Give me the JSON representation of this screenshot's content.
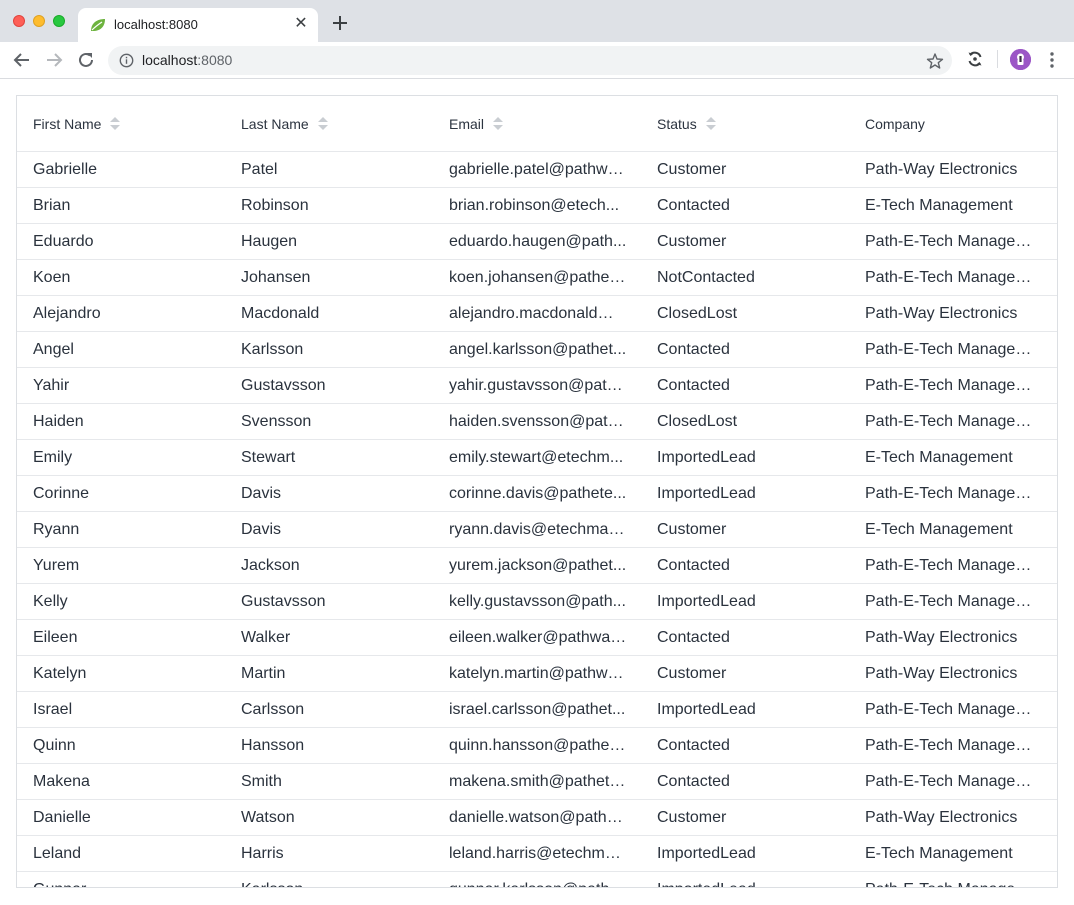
{
  "browser": {
    "tab_title": "localhost:8080",
    "url_host": "localhost",
    "url_port": ":8080"
  },
  "icons": {
    "favicon": "spring-leaf-icon",
    "tab_close": "close-icon",
    "new_tab": "plus-icon",
    "back": "arrow-left-icon",
    "forward": "arrow-right-icon",
    "reload": "reload-icon",
    "site_info": "info-icon",
    "bookmark": "star-icon",
    "extension": "sync-extension-icon",
    "profile": "avatar",
    "menu": "kebab-menu-icon"
  },
  "colors": {
    "traffic_red": "#fe5f57",
    "traffic_yellow": "#febc2e",
    "traffic_green": "#28c840",
    "favicon_green": "#6db33f",
    "avatar_purple": "#9b56c6"
  },
  "grid": {
    "columns": [
      {
        "label": "First Name",
        "sortable": true
      },
      {
        "label": "Last Name",
        "sortable": true
      },
      {
        "label": "Email",
        "sortable": true
      },
      {
        "label": "Status",
        "sortable": true
      },
      {
        "label": "Company",
        "sortable": false
      }
    ],
    "rows": [
      {
        "first": "Gabrielle",
        "last": "Patel",
        "email": "gabrielle.patel@pathwa...",
        "status": "Customer",
        "company": "Path-Way Electronics"
      },
      {
        "first": "Brian",
        "last": "Robinson",
        "email": "brian.robinson@etech...",
        "status": "Contacted",
        "company": "E-Tech Management"
      },
      {
        "first": "Eduardo",
        "last": "Haugen",
        "email": "eduardo.haugen@path...",
        "status": "Customer",
        "company": "Path-E-Tech Managem..."
      },
      {
        "first": "Koen",
        "last": "Johansen",
        "email": "koen.johansen@pathet...",
        "status": "NotContacted",
        "company": "Path-E-Tech Managem..."
      },
      {
        "first": "Alejandro",
        "last": "Macdonald",
        "email": "alejandro.macdonald@...",
        "status": "ClosedLost",
        "company": "Path-Way Electronics"
      },
      {
        "first": "Angel",
        "last": "Karlsson",
        "email": "angel.karlsson@pathet...",
        "status": "Contacted",
        "company": "Path-E-Tech Managem..."
      },
      {
        "first": "Yahir",
        "last": "Gustavsson",
        "email": "yahir.gustavsson@path...",
        "status": "Contacted",
        "company": "Path-E-Tech Managem..."
      },
      {
        "first": "Haiden",
        "last": "Svensson",
        "email": "haiden.svensson@path...",
        "status": "ClosedLost",
        "company": "Path-E-Tech Managem..."
      },
      {
        "first": "Emily",
        "last": "Stewart",
        "email": "emily.stewart@etechm...",
        "status": "ImportedLead",
        "company": "E-Tech Management"
      },
      {
        "first": "Corinne",
        "last": "Davis",
        "email": "corinne.davis@pathete...",
        "status": "ImportedLead",
        "company": "Path-E-Tech Managem..."
      },
      {
        "first": "Ryann",
        "last": "Davis",
        "email": "ryann.davis@etechman...",
        "status": "Customer",
        "company": "E-Tech Management"
      },
      {
        "first": "Yurem",
        "last": "Jackson",
        "email": "yurem.jackson@pathet...",
        "status": "Contacted",
        "company": "Path-E-Tech Managem..."
      },
      {
        "first": "Kelly",
        "last": "Gustavsson",
        "email": "kelly.gustavsson@path...",
        "status": "ImportedLead",
        "company": "Path-E-Tech Managem..."
      },
      {
        "first": "Eileen",
        "last": "Walker",
        "email": "eileen.walker@pathway...",
        "status": "Contacted",
        "company": "Path-Way Electronics"
      },
      {
        "first": "Katelyn",
        "last": "Martin",
        "email": "katelyn.martin@pathwa...",
        "status": "Customer",
        "company": "Path-Way Electronics"
      },
      {
        "first": "Israel",
        "last": "Carlsson",
        "email": "israel.carlsson@pathet...",
        "status": "ImportedLead",
        "company": "Path-E-Tech Managem..."
      },
      {
        "first": "Quinn",
        "last": "Hansson",
        "email": "quinn.hansson@pathet...",
        "status": "Contacted",
        "company": "Path-E-Tech Managem..."
      },
      {
        "first": "Makena",
        "last": "Smith",
        "email": "makena.smith@pathete...",
        "status": "Contacted",
        "company": "Path-E-Tech Managem..."
      },
      {
        "first": "Danielle",
        "last": "Watson",
        "email": "danielle.watson@pathw...",
        "status": "Customer",
        "company": "Path-Way Electronics"
      },
      {
        "first": "Leland",
        "last": "Harris",
        "email": "leland.harris@etechma...",
        "status": "ImportedLead",
        "company": "E-Tech Management"
      },
      {
        "first": "Gunnar",
        "last": "Karlsson",
        "email": "gunnar.karlsson@pathet...",
        "status": "ImportedLead",
        "company": "Path-E-Tech Managem..."
      }
    ]
  }
}
